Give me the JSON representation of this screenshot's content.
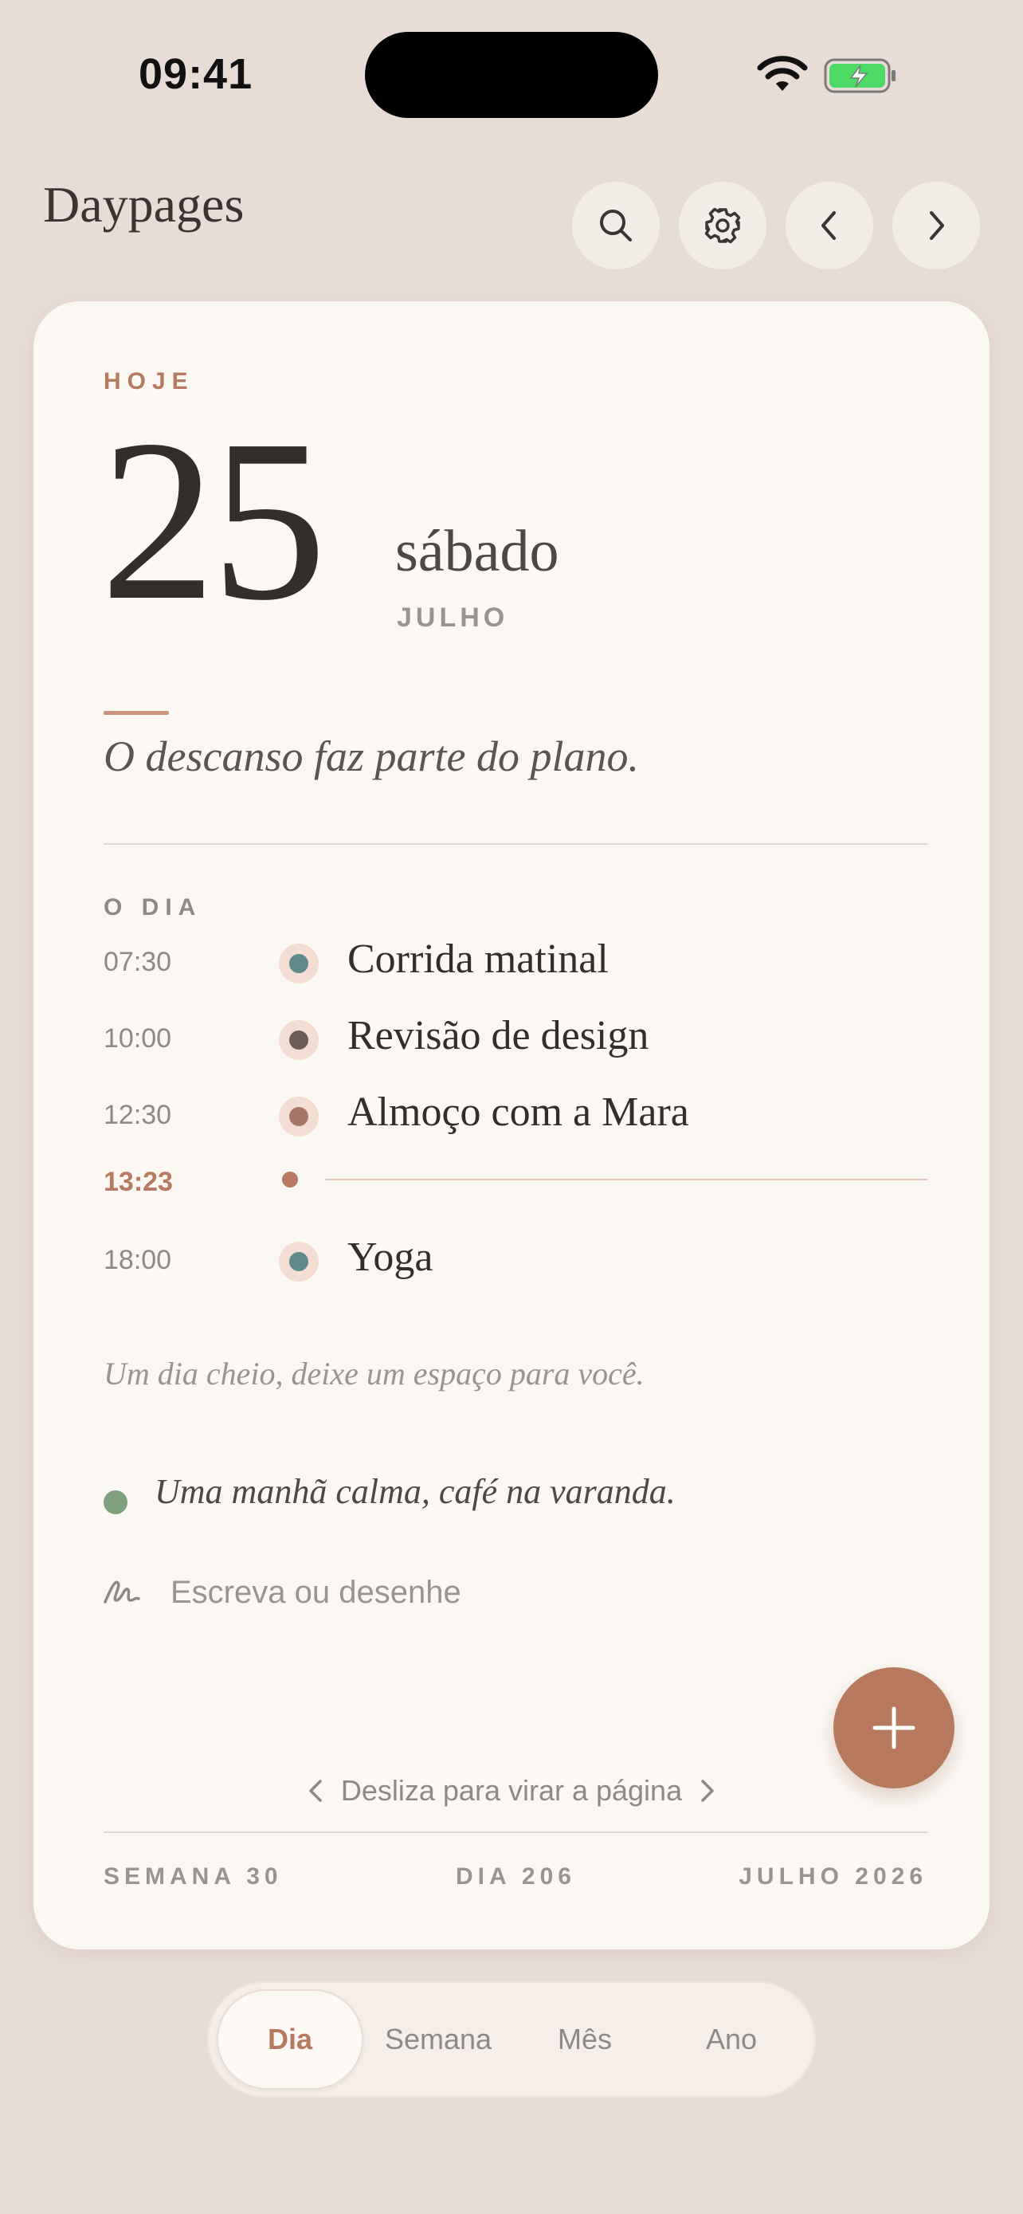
{
  "status_bar": {
    "time": "09:41"
  },
  "header": {
    "title": "Daypages"
  },
  "day": {
    "today_label": "HOJE",
    "number": "25",
    "weekday": "sábado",
    "month": "JULHO",
    "quote": "O descanso faz parte do plano."
  },
  "agenda": {
    "section_label": "O DIA",
    "events": [
      {
        "time": "07:30",
        "title": "Corrida matinal",
        "color": "#5e8a8c"
      },
      {
        "time": "10:00",
        "title": "Revisão de design",
        "color": "#6e5d57"
      },
      {
        "time": "12:30",
        "title": "Almoço com a Mara",
        "color": "#a87468"
      },
      {
        "time": "18:00",
        "title": "Yoga",
        "color": "#5e8a8c"
      }
    ],
    "now_time": "13:23",
    "hint": "Um dia cheio, deixe um espaço para você."
  },
  "note": {
    "text": "Uma manhã calma, café na varanda.",
    "color": "#7fa07c"
  },
  "compose": {
    "placeholder": "Escreva ou desenhe"
  },
  "swipe_hint": "Desliza para virar a página",
  "footer": {
    "week": "SEMANA 30",
    "day": "DIA 206",
    "month_year": "JULHO 2026"
  },
  "tabs": [
    {
      "label": "Dia",
      "active": true
    },
    {
      "label": "Semana",
      "active": false
    },
    {
      "label": "Mês",
      "active": false
    },
    {
      "label": "Ano",
      "active": false
    }
  ],
  "colors": {
    "accent": "#b57a60",
    "background": "#e8ddd6",
    "card": "#fbf8f4"
  }
}
